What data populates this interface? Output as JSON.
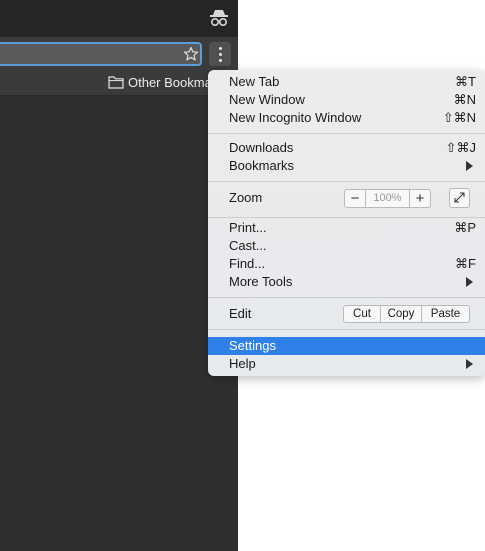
{
  "browser": {
    "bookmarks_bar": {
      "folder_label": "Other Bookmarks"
    }
  },
  "menu": {
    "new_tab": {
      "label": "New Tab",
      "shortcut": "⌘T"
    },
    "new_window": {
      "label": "New Window",
      "shortcut": "⌘N"
    },
    "new_incognito": {
      "label": "New Incognito Window",
      "shortcut": "⇧⌘N"
    },
    "downloads": {
      "label": "Downloads",
      "shortcut": "⇧⌘J"
    },
    "bookmarks": {
      "label": "Bookmarks"
    },
    "zoom": {
      "label": "Zoom",
      "minus": "−",
      "value": "100%",
      "plus": "+"
    },
    "print": {
      "label": "Print...",
      "shortcut": "⌘P"
    },
    "cast": {
      "label": "Cast..."
    },
    "find": {
      "label": "Find...",
      "shortcut": "⌘F"
    },
    "more_tools": {
      "label": "More Tools"
    },
    "edit": {
      "label": "Edit",
      "cut": "Cut",
      "copy": "Copy",
      "paste": "Paste"
    },
    "settings": {
      "label": "Settings"
    },
    "help": {
      "label": "Help"
    }
  },
  "colors": {
    "selection": "#2f81e8",
    "focus_ring": "#5b9dd9"
  },
  "icons": [
    "incognito-icon",
    "star-icon",
    "menu-dots-icon",
    "folder-icon",
    "submenu-arrow-icon",
    "fullscreen-icon"
  ]
}
